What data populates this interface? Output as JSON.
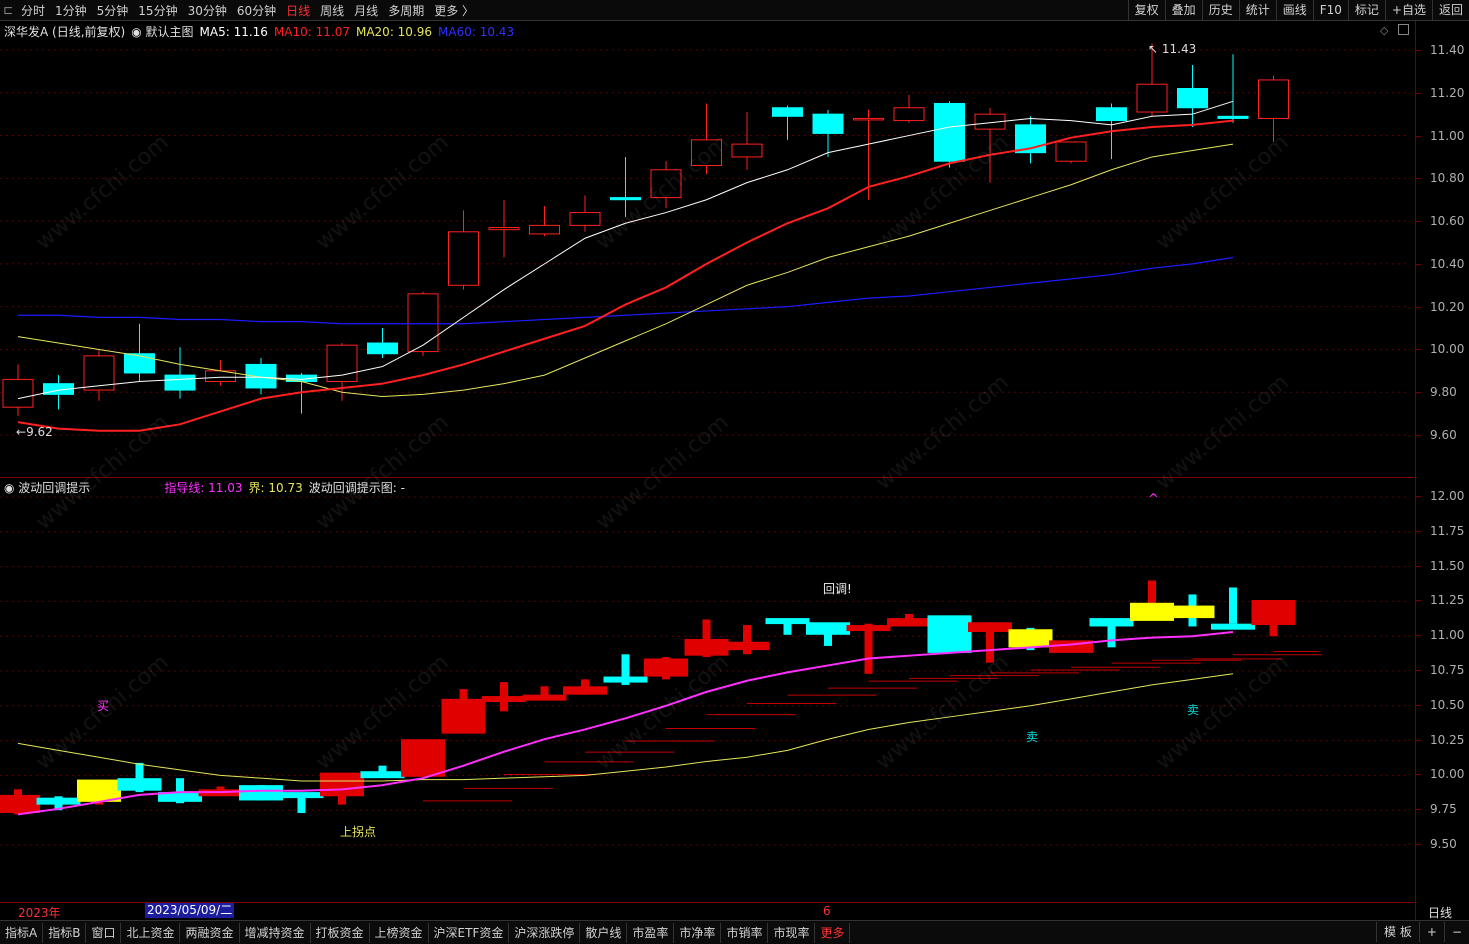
{
  "toolbar": {
    "left_items": [
      "分时",
      "1分钟",
      "5分钟",
      "15分钟",
      "30分钟",
      "60分钟",
      "日线",
      "周线",
      "月线",
      "多周期",
      "更多 〉"
    ],
    "active_index": 6,
    "right_items": [
      "复权",
      "叠加",
      "历史",
      "统计",
      "画线",
      "F10",
      "标记",
      "+自选",
      "返回"
    ]
  },
  "main_legend": {
    "stock": "深华发A (日线,前复权)",
    "template": "默认主图",
    "ma5": "MA5: 11.16",
    "ma10": "MA10: 11.07",
    "ma20": "MA20: 10.96",
    "ma60": "MA60: 10.43"
  },
  "sub_legend": {
    "name": "波动回调提示",
    "guide": "指导线: 11.03",
    "bound": "界: 10.73",
    "hint": "波动回调提示图: -"
  },
  "main_axis": [
    "11.40",
    "11.20",
    "11.00",
    "10.80",
    "10.60",
    "10.40",
    "10.20",
    "10.00",
    "9.80",
    "9.60"
  ],
  "sub_axis": [
    "12.00",
    "11.75",
    "11.50",
    "11.25",
    "11.00",
    "10.75",
    "10.50",
    "10.25",
    "10.00",
    "9.75",
    "9.50"
  ],
  "markers": {
    "high": "11.43",
    "low": "9.62",
    "buy": "买",
    "sell1": "卖",
    "sell2": "卖",
    "pullback": "回调!",
    "turn": "上拐点",
    "caret": "^"
  },
  "time_axis": {
    "year": "2023年",
    "cursor_date": "2023/05/09/二",
    "month": "6",
    "period": "日线"
  },
  "bottom_tabs": [
    "指标A",
    "指标B",
    "窗口",
    "北上资金",
    "两融资金",
    "增减持资金",
    "打板资金",
    "上榜资金",
    "沪深ETF资金",
    "沪深涨跌停",
    "散户线",
    "市盈率",
    "市净率",
    "市销率",
    "市现率",
    "更多"
  ],
  "bottom_right": [
    "模 板",
    "+",
    "−"
  ],
  "watermark": "www.cfchi.com",
  "colors": {
    "up": "#ff2020",
    "down": "#00ffff",
    "ma5": "#ffffff",
    "ma10": "#ff2020",
    "ma20": "#e6e65a",
    "ma60": "#1c1cff",
    "guide": "#ff30ff",
    "bound": "#e6e65a",
    "highlight": "#ffff00"
  },
  "chart_data": [
    {
      "type": "candlestick",
      "title": "",
      "ylim": [
        9.5,
        11.5
      ],
      "candles": [
        {
          "o": 9.73,
          "c": 9.86,
          "h": 9.93,
          "l": 9.69
        },
        {
          "o": 9.84,
          "c": 9.79,
          "h": 9.88,
          "l": 9.72
        },
        {
          "o": 9.81,
          "c": 9.97,
          "h": 10.0,
          "l": 9.76
        },
        {
          "o": 9.98,
          "c": 9.89,
          "h": 10.12,
          "l": 9.85
        },
        {
          "o": 9.88,
          "c": 9.81,
          "h": 10.01,
          "l": 9.77
        },
        {
          "o": 9.85,
          "c": 9.9,
          "h": 9.95,
          "l": 9.83
        },
        {
          "o": 9.93,
          "c": 9.82,
          "h": 9.96,
          "l": 9.79
        },
        {
          "o": 9.88,
          "c": 9.85,
          "h": 9.89,
          "l": 9.7
        },
        {
          "o": 9.85,
          "c": 10.02,
          "h": 10.03,
          "l": 9.76
        },
        {
          "o": 10.03,
          "c": 9.98,
          "h": 10.1,
          "l": 9.96
        },
        {
          "o": 9.99,
          "c": 10.26,
          "h": 10.27,
          "l": 9.97
        },
        {
          "o": 10.3,
          "c": 10.55,
          "h": 10.65,
          "l": 10.28
        },
        {
          "o": 10.56,
          "c": 10.57,
          "h": 10.7,
          "l": 10.43
        },
        {
          "o": 10.54,
          "c": 10.58,
          "h": 10.67,
          "l": 10.53
        },
        {
          "o": 10.58,
          "c": 10.64,
          "h": 10.72,
          "l": 10.55
        },
        {
          "o": 10.71,
          "c": 10.7,
          "h": 10.9,
          "l": 10.62
        },
        {
          "o": 10.71,
          "c": 10.84,
          "h": 10.88,
          "l": 10.66
        },
        {
          "o": 10.86,
          "c": 10.98,
          "h": 11.15,
          "l": 10.82
        },
        {
          "o": 10.9,
          "c": 10.96,
          "h": 11.11,
          "l": 10.84
        },
        {
          "o": 11.13,
          "c": 11.09,
          "h": 11.14,
          "l": 10.98
        },
        {
          "o": 11.1,
          "c": 11.01,
          "h": 11.12,
          "l": 10.9
        },
        {
          "o": 11.08,
          "c": 11.08,
          "h": 11.12,
          "l": 10.7
        },
        {
          "o": 11.07,
          "c": 11.13,
          "h": 11.19,
          "l": 11.06
        },
        {
          "o": 11.15,
          "c": 10.88,
          "h": 11.16,
          "l": 10.85
        },
        {
          "o": 11.03,
          "c": 11.1,
          "h": 11.13,
          "l": 10.78
        },
        {
          "o": 11.05,
          "c": 10.92,
          "h": 11.09,
          "l": 10.87
        },
        {
          "o": 10.88,
          "c": 10.97,
          "h": 10.97,
          "l": 10.87
        },
        {
          "o": 11.13,
          "c": 11.07,
          "h": 11.15,
          "l": 10.89
        },
        {
          "o": 11.11,
          "c": 11.24,
          "h": 11.43,
          "l": 11.09
        },
        {
          "o": 11.22,
          "c": 11.13,
          "h": 11.33,
          "l": 11.04
        },
        {
          "o": 11.09,
          "c": 11.08,
          "h": 11.38,
          "l": 11.06
        },
        {
          "o": 11.08,
          "c": 11.26,
          "h": 11.28,
          "l": 10.97
        }
      ],
      "ma5": [
        9.77,
        9.81,
        9.83,
        9.85,
        9.86,
        9.87,
        9.87,
        9.86,
        9.88,
        9.92,
        10.02,
        10.15,
        10.28,
        10.4,
        10.52,
        10.59,
        10.64,
        10.7,
        10.78,
        10.84,
        10.92,
        10.96,
        11.0,
        11.04,
        11.06,
        11.08,
        11.07,
        11.05,
        11.09,
        11.1,
        11.16
      ],
      "ma10": [
        9.66,
        9.63,
        9.62,
        9.62,
        9.65,
        9.71,
        9.77,
        9.8,
        9.82,
        9.84,
        9.88,
        9.93,
        9.99,
        10.05,
        10.11,
        10.21,
        10.29,
        10.4,
        10.5,
        10.59,
        10.66,
        10.76,
        10.81,
        10.87,
        10.91,
        10.94,
        10.99,
        11.02,
        11.04,
        11.05,
        11.07
      ],
      "ma20": [
        10.06,
        10.03,
        10.0,
        9.97,
        9.93,
        9.9,
        9.87,
        9.85,
        9.8,
        9.78,
        9.79,
        9.81,
        9.84,
        9.88,
        9.96,
        10.04,
        10.12,
        10.21,
        10.3,
        10.36,
        10.43,
        10.48,
        10.53,
        10.59,
        10.65,
        10.71,
        10.77,
        10.84,
        10.9,
        10.93,
        10.96
      ],
      "ma60": [
        10.16,
        10.16,
        10.15,
        10.15,
        10.14,
        10.14,
        10.13,
        10.13,
        10.12,
        10.12,
        10.12,
        10.12,
        10.13,
        10.14,
        10.15,
        10.16,
        10.17,
        10.18,
        10.19,
        10.2,
        10.22,
        10.24,
        10.25,
        10.27,
        10.29,
        10.31,
        10.33,
        10.35,
        10.38,
        10.4,
        10.43
      ]
    },
    {
      "type": "bar",
      "title": "",
      "ylim": [
        9.4,
        12.1
      ],
      "guide": [
        9.72,
        9.76,
        9.81,
        9.86,
        9.88,
        9.88,
        9.89,
        9.89,
        9.9,
        9.93,
        9.98,
        10.07,
        10.17,
        10.26,
        10.33,
        10.41,
        10.5,
        10.6,
        10.68,
        10.74,
        10.79,
        10.84,
        10.86,
        10.88,
        10.9,
        10.92,
        10.94,
        10.97,
        10.99,
        11.0,
        11.03
      ],
      "bound": [
        10.23,
        10.18,
        10.13,
        10.08,
        10.04,
        10.0,
        9.98,
        9.96,
        9.96,
        9.96,
        9.97,
        9.97,
        9.98,
        9.99,
        10.0,
        10.03,
        10.06,
        10.1,
        10.13,
        10.18,
        10.26,
        10.33,
        10.38,
        10.42,
        10.46,
        10.5,
        10.55,
        10.6,
        10.65,
        10.69,
        10.73
      ]
    }
  ]
}
